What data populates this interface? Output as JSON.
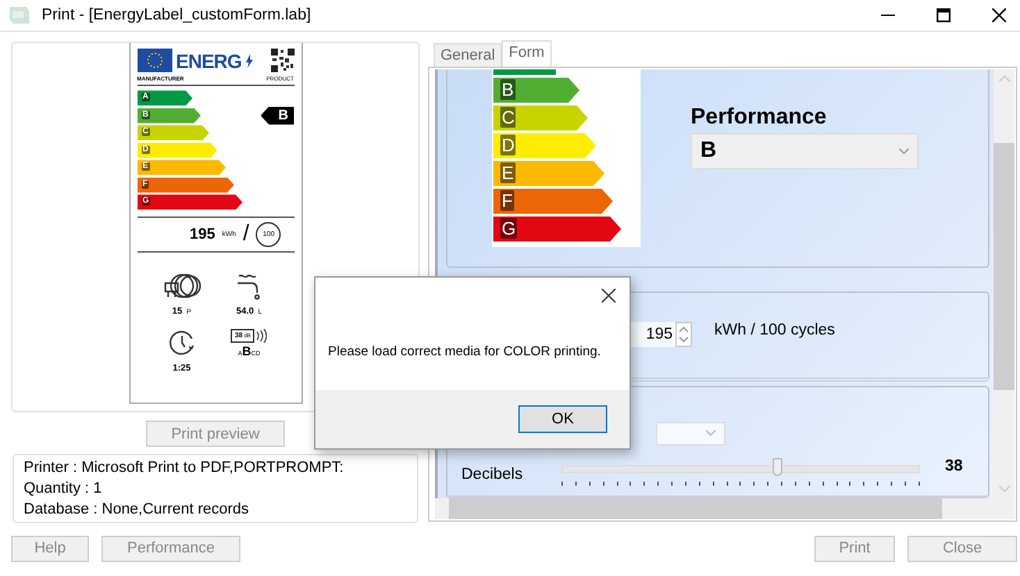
{
  "window": {
    "title": "Print - [EnergyLabel_customForm.lab]"
  },
  "label_preview": {
    "brand": "ENERG",
    "manufacturer": "MANUFACTURER",
    "product": "PRODUCT",
    "rating": "B",
    "scale": [
      {
        "letter": "A",
        "color": "#009a44",
        "selected": false
      },
      {
        "letter": "B",
        "color": "#52ae32",
        "selected": true
      },
      {
        "letter": "C",
        "color": "#c8d400",
        "selected": false
      },
      {
        "letter": "D",
        "color": "#ffed00",
        "selected": false
      },
      {
        "letter": "E",
        "color": "#fbba00",
        "selected": false
      },
      {
        "letter": "F",
        "color": "#ec6608",
        "selected": false
      },
      {
        "letter": "G",
        "color": "#e30613",
        "selected": false
      }
    ],
    "energy": "195",
    "energy_unit": "kWh",
    "slash": "/",
    "cycles": "100",
    "place_settings": "15",
    "place_unit": "P",
    "water": "54.0",
    "water_unit": "L",
    "duration": "1:25",
    "noise": "38",
    "noise_unit": "dB",
    "noise_classes": [
      {
        "letter": "A",
        "selected": false
      },
      {
        "letter": "B",
        "selected": true
      },
      {
        "letter": "C",
        "selected": false
      },
      {
        "letter": "D",
        "selected": false
      }
    ]
  },
  "print_preview_button": "Print preview",
  "info": [
    "Printer : Microsoft Print to PDF,PORTPROMPT:",
    "Quantity : 1",
    "Database : None,Current records"
  ],
  "tabs": [
    {
      "label": "General",
      "selected": false
    },
    {
      "label": "Form",
      "selected": true
    }
  ],
  "form": {
    "scale": [
      {
        "letter": "B",
        "color": "#52ae32"
      },
      {
        "letter": "C",
        "color": "#c8d400"
      },
      {
        "letter": "D",
        "color": "#ffed00"
      },
      {
        "letter": "E",
        "color": "#fbba00"
      },
      {
        "letter": "F",
        "color": "#ec6608"
      },
      {
        "letter": "G",
        "color": "#e30613"
      }
    ],
    "performance_label": "Performance",
    "performance_value": "B",
    "energy_value": "195",
    "energy_unit": "kWh / 100 cycles",
    "decibels_label": "Decibels",
    "decibels": {
      "level": 0.6,
      "reading": "38"
    }
  },
  "dialog": {
    "message": "Please load correct media for COLOR printing.",
    "ok": "OK"
  },
  "footer": {
    "left": [
      "Help",
      "Performance"
    ],
    "right": [
      "Print",
      "Close"
    ]
  }
}
